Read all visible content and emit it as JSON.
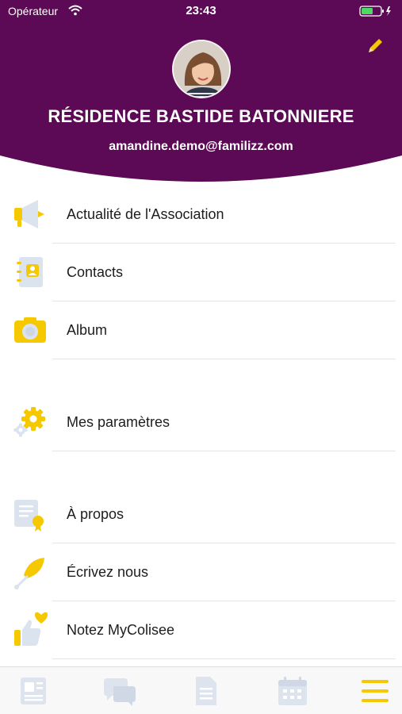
{
  "status_bar": {
    "carrier": "Opérateur",
    "time": "23:43"
  },
  "header": {
    "organization": "RÉSIDENCE BASTIDE BATONNIERE",
    "email": "amandine.demo@familizz.com"
  },
  "menu": {
    "items": [
      {
        "label": "Actualité de l'Association",
        "icon": "megaphone-icon"
      },
      {
        "label": "Contacts",
        "icon": "address-book-icon"
      },
      {
        "label": "Album",
        "icon": "camera-icon"
      },
      {
        "label": "Mes paramètres",
        "icon": "gear-icon"
      },
      {
        "label": "À propos",
        "icon": "certificate-icon"
      },
      {
        "label": "Écrivez nous",
        "icon": "feather-pen-icon"
      },
      {
        "label": "Notez MyColisee",
        "icon": "thumbs-up-heart-icon"
      }
    ]
  },
  "tabbar": {
    "tabs": [
      {
        "icon": "news-icon",
        "active": false
      },
      {
        "icon": "chat-icon",
        "active": false
      },
      {
        "icon": "document-icon",
        "active": false
      },
      {
        "icon": "calendar-icon",
        "active": false
      },
      {
        "icon": "hamburger-menu-icon",
        "active": true
      }
    ]
  },
  "colors": {
    "header_background": "#5c0a55",
    "accent_yellow": "#f5c800",
    "inactive_icon": "#dde4ee"
  }
}
